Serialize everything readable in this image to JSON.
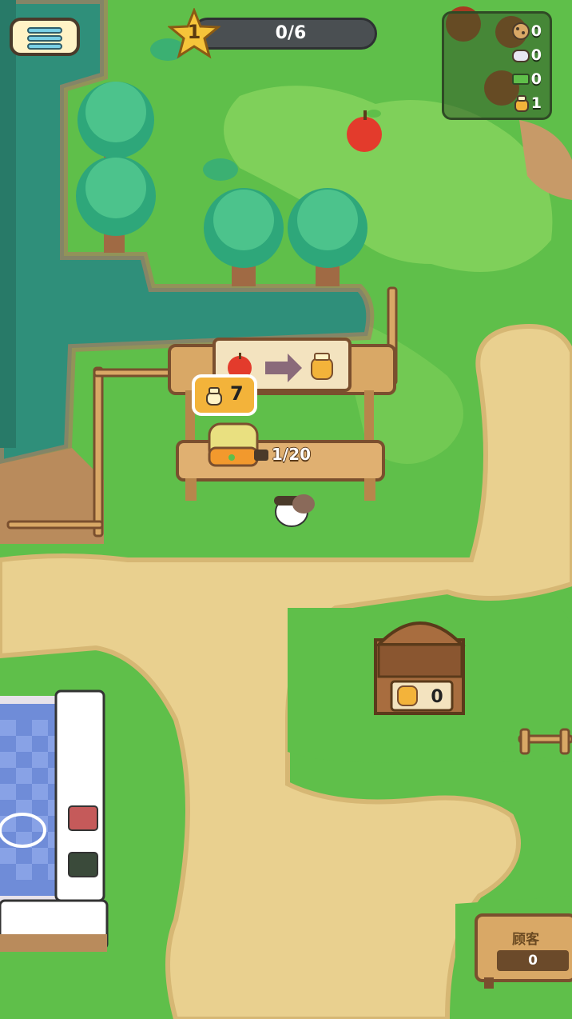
{
  "hud": {
    "menu_icon": "hamburger-menu-icon",
    "level": "1",
    "level_progress_text": "0/6",
    "level_progress": 0.0
  },
  "resources": [
    {
      "icon": "cookie-icon",
      "value": "0"
    },
    {
      "icon": "cloth-icon",
      "value": "0"
    },
    {
      "icon": "cash-icon",
      "value": "0"
    },
    {
      "icon": "honey-jar-icon",
      "value": "1"
    }
  ],
  "stand": {
    "recipe_input_icon": "apple-icon",
    "recipe_output_icon": "honey-jar-icon",
    "stock_count": "7",
    "capacity_text": "1/20"
  },
  "chest": {
    "icon": "honey-jar-icon",
    "value": "0"
  },
  "customer_sign": {
    "label": "顾客",
    "value": "0"
  },
  "colors": {
    "grass": "#5fbf4a",
    "grass_light": "#7fd05a",
    "water": "#2f8f7a",
    "path": "#e9d08f",
    "wood": "#d9a866",
    "gold": "#f3b33a"
  }
}
